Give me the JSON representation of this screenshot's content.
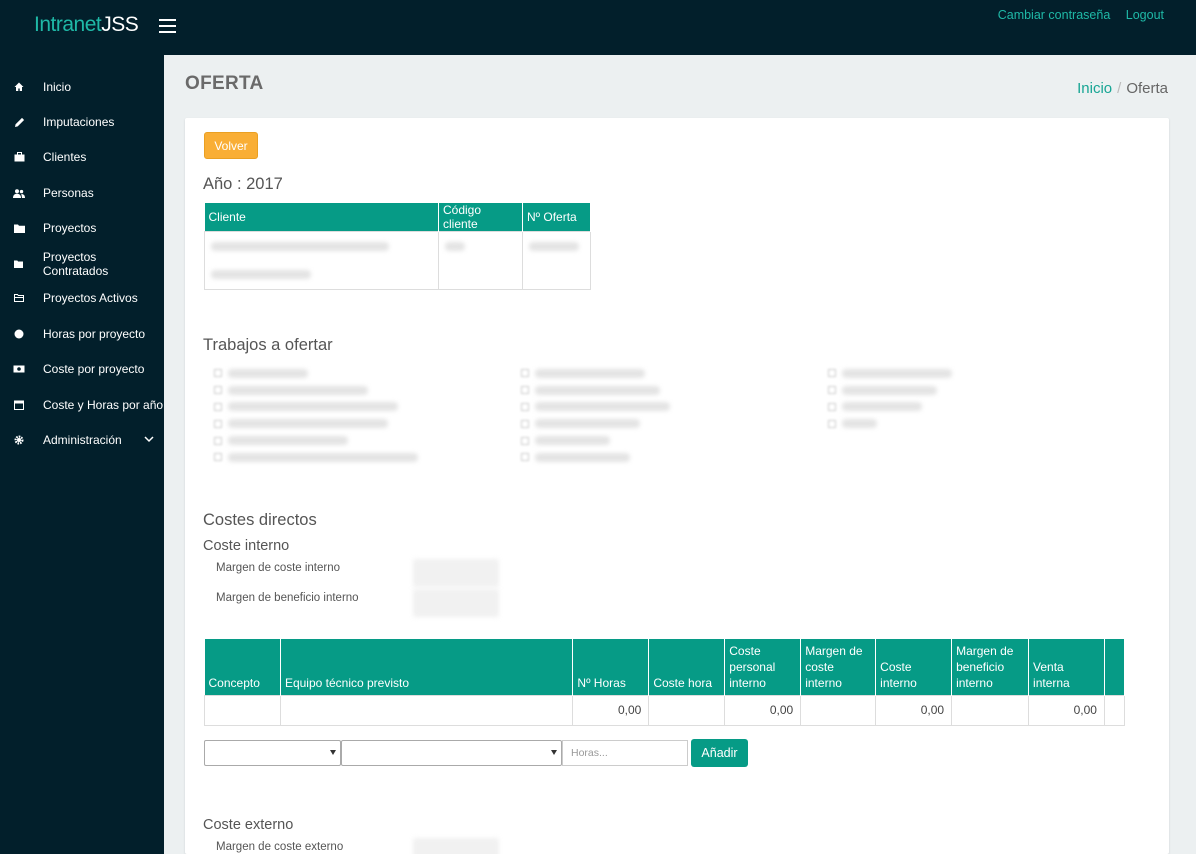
{
  "brand": {
    "part1": "Intranet",
    "part2": "JSS"
  },
  "topbar": {
    "change_password": "Cambiar contraseña",
    "logout": "Logout"
  },
  "sidebar": {
    "items": [
      {
        "label": "Inicio",
        "icon": "home-icon"
      },
      {
        "label": "Imputaciones",
        "icon": "pencil-icon"
      },
      {
        "label": "Clientes",
        "icon": "briefcase-icon"
      },
      {
        "label": "Personas",
        "icon": "users-icon"
      },
      {
        "label": "Proyectos",
        "icon": "folder-icon"
      },
      {
        "label": "Proyectos Contratados",
        "icon": "folder-small-icon"
      },
      {
        "label": "Proyectos Activos",
        "icon": "folder-open-icon"
      },
      {
        "label": "Horas por proyecto",
        "icon": "circle-icon"
      },
      {
        "label": "Coste por proyecto",
        "icon": "money-icon"
      },
      {
        "label": "Coste y Horas por año",
        "icon": "calendar-icon"
      },
      {
        "label": "Administración",
        "icon": "gear-icon"
      }
    ]
  },
  "page": {
    "title": "OFERTA"
  },
  "breadcrumb": {
    "home": "Inicio",
    "separator": "/",
    "current": "Oferta"
  },
  "card": {
    "back_button": "Volver",
    "year_heading": "Año : 2017",
    "client_table": {
      "headers": [
        "Cliente",
        "Código cliente",
        "Nº Oferta"
      ]
    },
    "works_heading": "Trabajos a ofertar",
    "direct_costs_heading": "Costes directos",
    "internal_cost_heading": "Coste interno",
    "internal_cost_margin_label": "Margen de coste interno",
    "internal_profit_margin_label": "Margen de beneficio interno",
    "cost_table": {
      "headers": [
        "Concepto",
        "Equipo técnico previsto",
        "Nº Horas",
        "Coste hora",
        "Coste personal interno",
        "Margen de coste interno",
        "Coste interno",
        "Margen de beneficio interno",
        "Venta interna",
        ""
      ],
      "row": [
        "",
        "",
        "0,00",
        "",
        "0,00",
        "",
        "0,00",
        "",
        "0,00",
        ""
      ]
    },
    "hours_placeholder": "Horas...",
    "add_button": "Añadir",
    "external_cost_heading": "Coste externo",
    "external_cost_margin_label": "Margen de coste externo"
  },
  "colors": {
    "topbar": "#021f2b",
    "accent": "#069b86",
    "brand_accent": "#1fb9a7",
    "warning": "#f9ae35"
  }
}
